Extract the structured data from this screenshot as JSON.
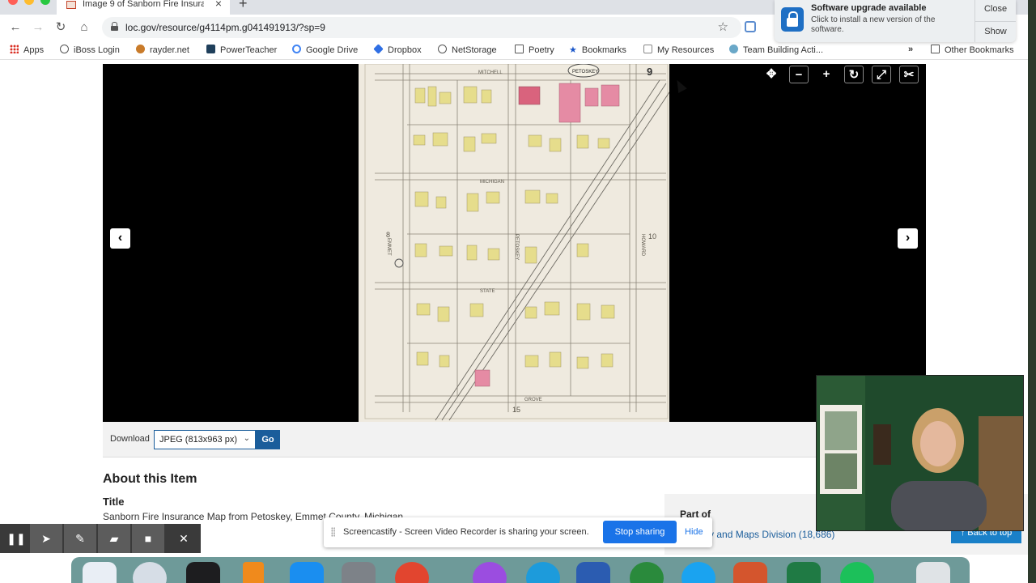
{
  "browser": {
    "tab_title": "Image 9 of Sanborn Fire Insura",
    "url": "loc.gov/resource/g4114pm.g041491913/?sp=9",
    "bookmarks": [
      "Apps",
      "iBoss Login",
      "rayder.net",
      "PowerTeacher",
      "Google Drive",
      "Dropbox",
      "NetStorage",
      "Poetry",
      "Bookmarks",
      "My Resources",
      "Team Building Acti...",
      "Other Bookmarks"
    ],
    "overflow": "»"
  },
  "notification": {
    "title": "Software upgrade available",
    "body": "Click to install a new version of the software.",
    "close_label": "Close",
    "show_label": "Show"
  },
  "viewer": {
    "map_labels": {
      "sheet_number": "9",
      "city_seal": "PETOSKEY",
      "street_top": "MITCHELL",
      "street_mid": "MICHIGAN",
      "street_state": "STATE",
      "street_bottom": "GROVE",
      "left_sheet": "8",
      "right_sheet": "10",
      "bottom_sheet": "15",
      "street_emmet": "EMMET",
      "street_petoskey": "PETOSKEY",
      "street_howard": "HOWARD"
    }
  },
  "download": {
    "label": "Download",
    "selected": "JPEG (813x963 px)",
    "go_label": "Go"
  },
  "about": {
    "heading": "About this Item",
    "title_label": "Title",
    "title_value": "Sanborn Fire Insurance Map from Petoskey, Emmet County, Michigan",
    "part_of_label": "Part of",
    "part_of_link": "aphy and Maps Division (18,686)",
    "back_to_top": "↑ Back to top"
  },
  "screencastify": {
    "message": "Screencastify - Screen Video Recorder is sharing your screen.",
    "stop_label": "Stop sharing",
    "hide_label": "Hide"
  },
  "colors": {
    "loc_blue": "#1a5d9b",
    "stop_blue": "#1a73e8",
    "viewer_black": "#000000",
    "map_paper": "#efeadf",
    "building_yellow": "#e6dd8c",
    "building_pink": "#e58ba4"
  },
  "icons": {
    "viewer_controls": [
      "move-icon",
      "zoom-out-icon",
      "zoom-in-icon",
      "rotate-icon",
      "fullscreen-icon",
      "crop-icon"
    ],
    "recorder_tools": [
      "pause-icon",
      "pointer-icon",
      "pen-icon",
      "eraser-icon",
      "camera-icon",
      "close-icon"
    ]
  }
}
